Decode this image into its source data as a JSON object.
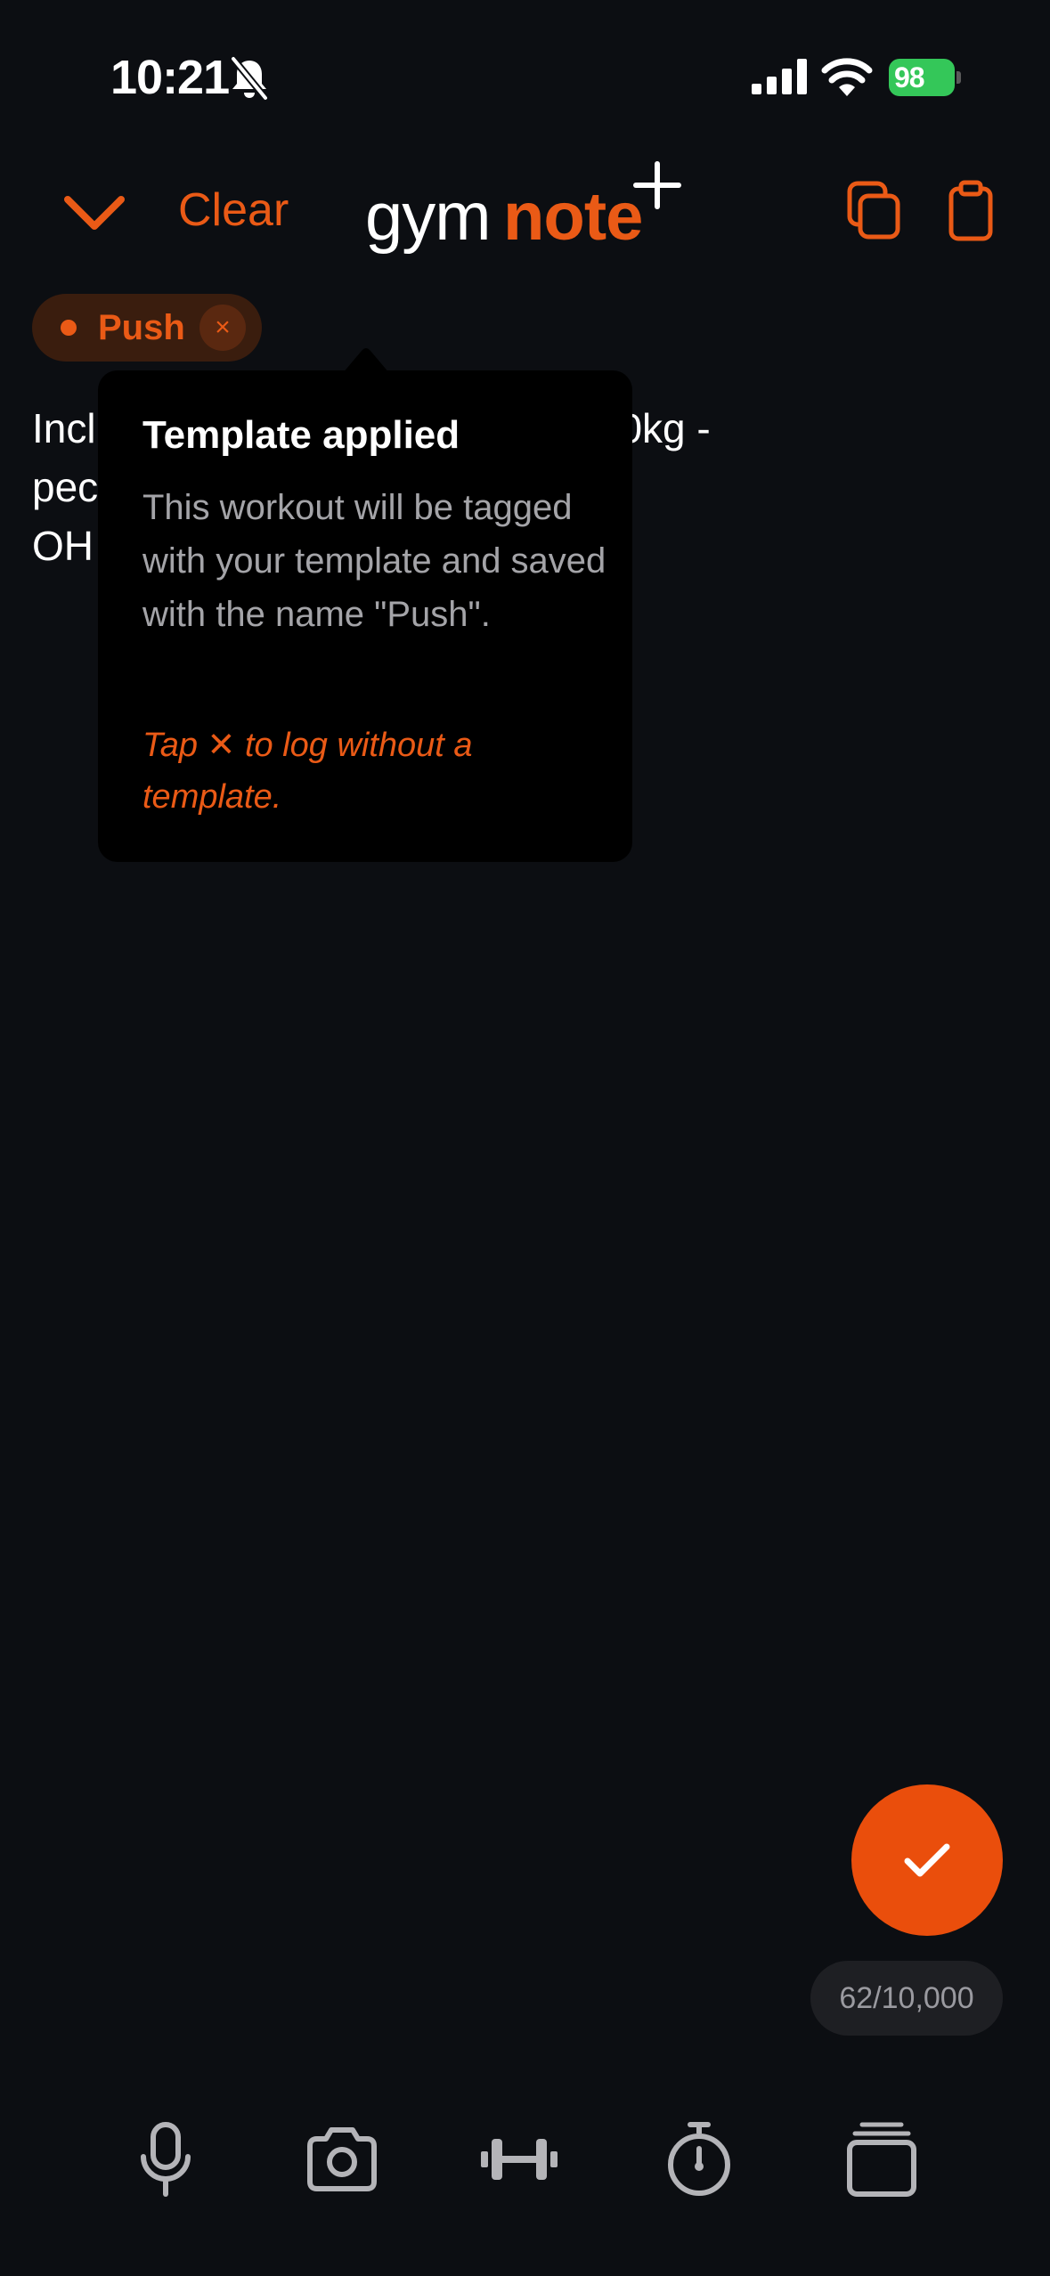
{
  "status_bar": {
    "time": "10:21",
    "battery": "98"
  },
  "header": {
    "clear_label": "Clear",
    "logo_gym": "gym",
    "logo_note": "note"
  },
  "template_chip": {
    "label": "Push",
    "close_glyph": "×"
  },
  "note": {
    "text": "Incl                                              0kg -\npec\nOH"
  },
  "tooltip": {
    "title": "Template applied",
    "body": "This workout will be tagged with your template and saved with the name \"Push\".",
    "hint": "Tap ✕ to log without a template."
  },
  "counter": {
    "text": "62/10,000"
  },
  "colors": {
    "accent": "#ea5a16",
    "background": "#0c0e12",
    "battery": "#34c759"
  },
  "icons": {
    "header": [
      "chevron-down-icon",
      "copy-icon",
      "clipboard-icon"
    ],
    "toolbar": [
      "microphone-icon",
      "camera-icon",
      "dumbbell-icon",
      "stopwatch-icon",
      "cards-icon"
    ]
  }
}
